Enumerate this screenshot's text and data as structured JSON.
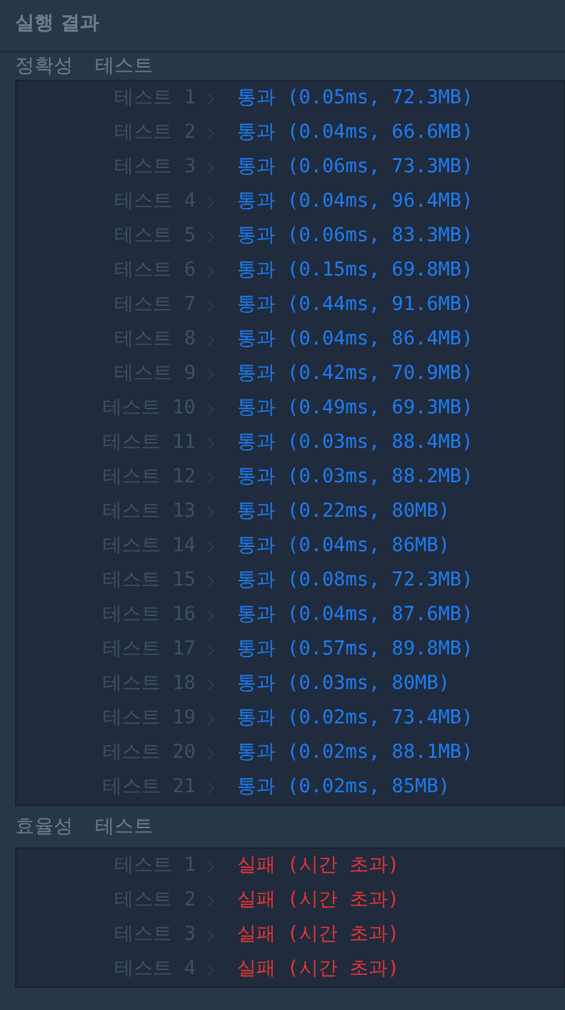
{
  "header": {
    "title": "실행 결과"
  },
  "sections": [
    {
      "title": "정확성",
      "subtitle": "테스트",
      "tests": [
        {
          "label": "테스트 1",
          "passed": true,
          "result": "통과 (0.05ms, 72.3MB)"
        },
        {
          "label": "테스트 2",
          "passed": true,
          "result": "통과 (0.04ms, 66.6MB)"
        },
        {
          "label": "테스트 3",
          "passed": true,
          "result": "통과 (0.06ms, 73.3MB)"
        },
        {
          "label": "테스트 4",
          "passed": true,
          "result": "통과 (0.04ms, 96.4MB)"
        },
        {
          "label": "테스트 5",
          "passed": true,
          "result": "통과 (0.06ms, 83.3MB)"
        },
        {
          "label": "테스트 6",
          "passed": true,
          "result": "통과 (0.15ms, 69.8MB)"
        },
        {
          "label": "테스트 7",
          "passed": true,
          "result": "통과 (0.44ms, 91.6MB)"
        },
        {
          "label": "테스트 8",
          "passed": true,
          "result": "통과 (0.04ms, 86.4MB)"
        },
        {
          "label": "테스트 9",
          "passed": true,
          "result": "통과 (0.42ms, 70.9MB)"
        },
        {
          "label": "테스트 10",
          "passed": true,
          "result": "통과 (0.49ms, 69.3MB)"
        },
        {
          "label": "테스트 11",
          "passed": true,
          "result": "통과 (0.03ms, 88.4MB)"
        },
        {
          "label": "테스트 12",
          "passed": true,
          "result": "통과 (0.03ms, 88.2MB)"
        },
        {
          "label": "테스트 13",
          "passed": true,
          "result": "통과 (0.22ms, 80MB)"
        },
        {
          "label": "테스트 14",
          "passed": true,
          "result": "통과 (0.04ms, 86MB)"
        },
        {
          "label": "테스트 15",
          "passed": true,
          "result": "통과 (0.08ms, 72.3MB)"
        },
        {
          "label": "테스트 16",
          "passed": true,
          "result": "통과 (0.04ms, 87.6MB)"
        },
        {
          "label": "테스트 17",
          "passed": true,
          "result": "통과 (0.57ms, 89.8MB)"
        },
        {
          "label": "테스트 18",
          "passed": true,
          "result": "통과 (0.03ms, 80MB)"
        },
        {
          "label": "테스트 19",
          "passed": true,
          "result": "통과 (0.02ms, 73.4MB)"
        },
        {
          "label": "테스트 20",
          "passed": true,
          "result": "통과 (0.02ms, 88.1MB)"
        },
        {
          "label": "테스트 21",
          "passed": true,
          "result": "통과 (0.02ms, 85MB)"
        }
      ]
    },
    {
      "title": "효율성",
      "subtitle": "테스트",
      "tests": [
        {
          "label": "테스트 1",
          "passed": false,
          "result": "실패 (시간 초과)"
        },
        {
          "label": "테스트 2",
          "passed": false,
          "result": "실패 (시간 초과)"
        },
        {
          "label": "테스트 3",
          "passed": false,
          "result": "실패 (시간 초과)"
        },
        {
          "label": "테스트 4",
          "passed": false,
          "result": "실패 (시간 초과)"
        }
      ]
    }
  ]
}
